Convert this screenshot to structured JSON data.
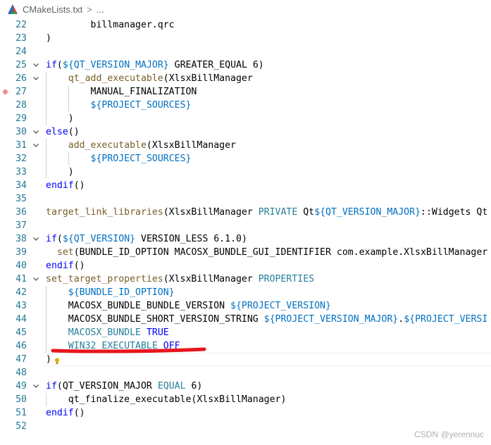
{
  "breadcrumb": {
    "file": "CMakeLists.txt",
    "sep": ">",
    "more": "..."
  },
  "watermark": "CSDN @yerennuc",
  "colors": {
    "line_number": "#237893",
    "function": "#795e26",
    "variable": "#0070c1",
    "constant": "#0000ff",
    "property": "#267f99",
    "annotation": "#e8141d"
  },
  "lines": [
    {
      "n": "22",
      "fold": "",
      "tokens": [
        {
          "t": "        billmanager.qrc",
          "c": ""
        }
      ]
    },
    {
      "n": "23",
      "fold": "",
      "tokens": [
        {
          "t": ")",
          "c": ""
        }
      ]
    },
    {
      "n": "24",
      "fold": "",
      "tokens": [
        {
          "t": "",
          "c": ""
        }
      ]
    },
    {
      "n": "25",
      "fold": "v",
      "tokens": [
        {
          "t": "if",
          "c": "k-const"
        },
        {
          "t": "(",
          "c": ""
        },
        {
          "t": "${",
          "c": "k-var"
        },
        {
          "t": "QT_VERSION_MAJOR",
          "c": "k-var"
        },
        {
          "t": "}",
          "c": "k-var"
        },
        {
          "t": " GREATER_EQUAL 6)",
          "c": ""
        }
      ]
    },
    {
      "n": "26",
      "fold": "v",
      "tokens": [
        {
          "t": "    ",
          "c": ""
        },
        {
          "t": "qt_add_executable",
          "c": "k-func"
        },
        {
          "t": "(XlsxBillManager",
          "c": ""
        }
      ]
    },
    {
      "n": "27",
      "fold": "",
      "tokens": [
        {
          "t": "        MANUAL_FINALIZATION",
          "c": ""
        }
      ]
    },
    {
      "n": "28",
      "fold": "",
      "tokens": [
        {
          "t": "        ",
          "c": ""
        },
        {
          "t": "${",
          "c": "k-var"
        },
        {
          "t": "PROJECT_SOURCES",
          "c": "k-var"
        },
        {
          "t": "}",
          "c": "k-var"
        }
      ]
    },
    {
      "n": "29",
      "fold": "",
      "tokens": [
        {
          "t": "    )",
          "c": ""
        }
      ]
    },
    {
      "n": "30",
      "fold": "v",
      "tokens": [
        {
          "t": "else",
          "c": "k-const"
        },
        {
          "t": "()",
          "c": ""
        }
      ]
    },
    {
      "n": "31",
      "fold": "v",
      "tokens": [
        {
          "t": "    ",
          "c": ""
        },
        {
          "t": "add_executable",
          "c": "k-func"
        },
        {
          "t": "(XlsxBillManager",
          "c": ""
        }
      ]
    },
    {
      "n": "32",
      "fold": "",
      "tokens": [
        {
          "t": "        ",
          "c": ""
        },
        {
          "t": "${",
          "c": "k-var"
        },
        {
          "t": "PROJECT_SOURCES",
          "c": "k-var"
        },
        {
          "t": "}",
          "c": "k-var"
        }
      ]
    },
    {
      "n": "33",
      "fold": "",
      "tokens": [
        {
          "t": "    )",
          "c": ""
        }
      ]
    },
    {
      "n": "34",
      "fold": "",
      "tokens": [
        {
          "t": "endif",
          "c": "k-const"
        },
        {
          "t": "()",
          "c": ""
        }
      ]
    },
    {
      "n": "35",
      "fold": "",
      "tokens": [
        {
          "t": "",
          "c": ""
        }
      ]
    },
    {
      "n": "36",
      "fold": "",
      "tokens": [
        {
          "t": "target_link_libraries",
          "c": "k-func"
        },
        {
          "t": "(XlsxBillManager ",
          "c": ""
        },
        {
          "t": "PRIVATE",
          "c": "k-prop"
        },
        {
          "t": " Qt",
          "c": ""
        },
        {
          "t": "${",
          "c": "k-var"
        },
        {
          "t": "QT_VERSION_MAJOR",
          "c": "k-var"
        },
        {
          "t": "}",
          "c": "k-var"
        },
        {
          "t": "::Widgets Qt",
          "c": ""
        }
      ]
    },
    {
      "n": "37",
      "fold": "",
      "tokens": [
        {
          "t": "",
          "c": ""
        }
      ]
    },
    {
      "n": "38",
      "fold": "v",
      "tokens": [
        {
          "t": "if",
          "c": "k-const"
        },
        {
          "t": "(",
          "c": ""
        },
        {
          "t": "${",
          "c": "k-var"
        },
        {
          "t": "QT_VERSION",
          "c": "k-var"
        },
        {
          "t": "}",
          "c": "k-var"
        },
        {
          "t": " VERSION_LESS 6.1.0)",
          "c": ""
        }
      ]
    },
    {
      "n": "39",
      "fold": "",
      "tokens": [
        {
          "t": "  ",
          "c": ""
        },
        {
          "t": "set",
          "c": "k-func"
        },
        {
          "t": "(BUNDLE_ID_OPTION MACOSX_BUNDLE_GUI_IDENTIFIER com.example.XlsxBillManager",
          "c": ""
        }
      ]
    },
    {
      "n": "40",
      "fold": "",
      "tokens": [
        {
          "t": "endif",
          "c": "k-const"
        },
        {
          "t": "()",
          "c": ""
        }
      ]
    },
    {
      "n": "41",
      "fold": "v",
      "tokens": [
        {
          "t": "set_target_properties",
          "c": "k-func"
        },
        {
          "t": "(XlsxBillManager ",
          "c": ""
        },
        {
          "t": "PROPERTIES",
          "c": "k-prop"
        }
      ]
    },
    {
      "n": "42",
      "fold": "",
      "tokens": [
        {
          "t": "    ",
          "c": ""
        },
        {
          "t": "${",
          "c": "k-var"
        },
        {
          "t": "BUNDLE_ID_OPTION",
          "c": "k-var"
        },
        {
          "t": "}",
          "c": "k-var"
        }
      ]
    },
    {
      "n": "43",
      "fold": "",
      "tokens": [
        {
          "t": "    MACOSX_BUNDLE_BUNDLE_VERSION ",
          "c": ""
        },
        {
          "t": "${",
          "c": "k-var"
        },
        {
          "t": "PROJECT_VERSION",
          "c": "k-var"
        },
        {
          "t": "}",
          "c": "k-var"
        }
      ]
    },
    {
      "n": "44",
      "fold": "",
      "tokens": [
        {
          "t": "    MACOSX_BUNDLE_SHORT_VERSION_STRING ",
          "c": ""
        },
        {
          "t": "${",
          "c": "k-var"
        },
        {
          "t": "PROJECT_VERSION_MAJOR",
          "c": "k-var"
        },
        {
          "t": "}",
          "c": "k-var"
        },
        {
          "t": ".",
          "c": ""
        },
        {
          "t": "${",
          "c": "k-var"
        },
        {
          "t": "PROJECT_VERSI",
          "c": "k-var"
        }
      ]
    },
    {
      "n": "45",
      "fold": "",
      "tokens": [
        {
          "t": "    ",
          "c": ""
        },
        {
          "t": "MACOSX_BUNDLE",
          "c": "k-prop"
        },
        {
          "t": " ",
          "c": ""
        },
        {
          "t": "TRUE",
          "c": "k-const"
        }
      ]
    },
    {
      "n": "46",
      "fold": "",
      "tokens": [
        {
          "t": "    ",
          "c": ""
        },
        {
          "t": "WIN32_EXECUTABLE",
          "c": "k-prop"
        },
        {
          "t": " ",
          "c": ""
        },
        {
          "t": "OFF",
          "c": "k-const"
        }
      ]
    },
    {
      "n": "47",
      "fold": "",
      "tokens": [
        {
          "t": ")",
          "c": ""
        }
      ]
    },
    {
      "n": "48",
      "fold": "",
      "tokens": [
        {
          "t": "",
          "c": ""
        }
      ]
    },
    {
      "n": "49",
      "fold": "v",
      "tokens": [
        {
          "t": "if",
          "c": "k-const"
        },
        {
          "t": "(QT_VERSION_MAJOR ",
          "c": ""
        },
        {
          "t": "EQUAL",
          "c": "k-prop"
        },
        {
          "t": " 6)",
          "c": ""
        }
      ]
    },
    {
      "n": "50",
      "fold": "",
      "tokens": [
        {
          "t": "    qt_finalize_executable(XlsxBillManager)",
          "c": ""
        }
      ]
    },
    {
      "n": "51",
      "fold": "",
      "tokens": [
        {
          "t": "endif",
          "c": "k-const"
        },
        {
          "t": "()",
          "c": ""
        }
      ]
    },
    {
      "n": "52",
      "fold": "",
      "tokens": [
        {
          "t": "",
          "c": ""
        }
      ]
    }
  ]
}
